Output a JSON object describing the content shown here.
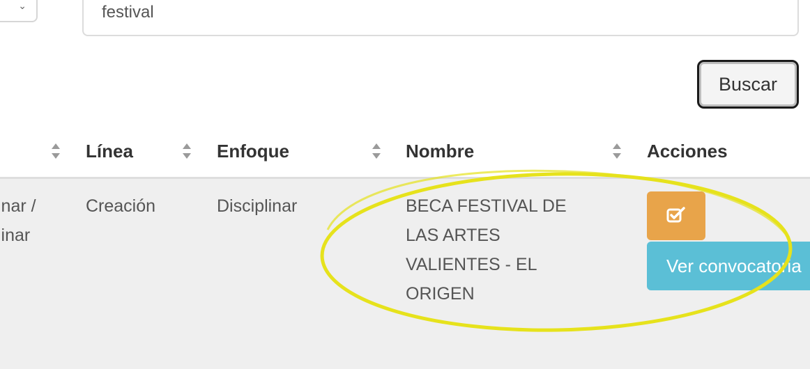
{
  "search": {
    "value": "festival"
  },
  "buttons": {
    "buscar_label": "Buscar"
  },
  "table": {
    "headers": {
      "linea": "Línea",
      "enfoque": "Enfoque",
      "nombre": "Nombre",
      "acciones": "Acciones"
    },
    "row": {
      "first_col_lines": [
        "inar /",
        "linar"
      ],
      "linea": "Creación",
      "enfoque": "Disciplinar",
      "nombre_lines": [
        "BECA FESTIVAL DE",
        "LAS ARTES",
        "VALIENTES - EL",
        "ORIGEN"
      ],
      "ver_label": "Ver convocatoria"
    }
  },
  "colors": {
    "edit_button": "#e8a44a",
    "ver_button": "#5bbfd6",
    "highlight_circle": "#e6e21c"
  },
  "icons": {
    "edit": "edit-check-icon",
    "sort": "sort-icon"
  }
}
